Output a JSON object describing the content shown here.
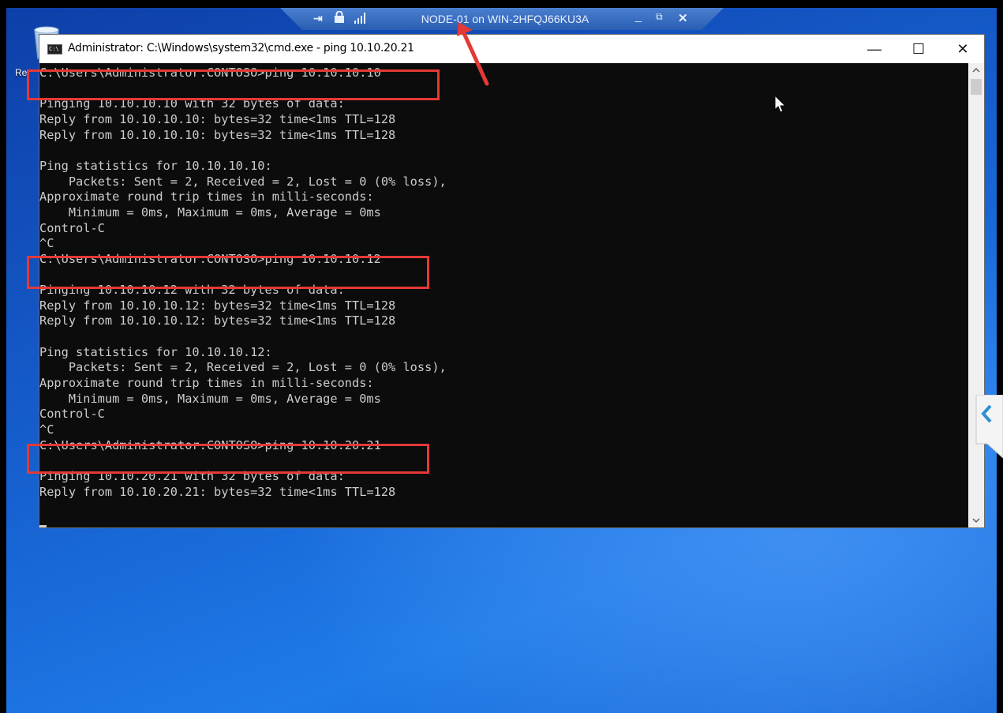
{
  "desktop": {
    "recycle_bin_label": "Re"
  },
  "rdp_bar": {
    "title": "NODE-01 on WIN-2HFQJ66KU3A",
    "pin_icon": "pin-icon",
    "lock_icon": "lock-icon",
    "signal_icon": "signal-bars-icon",
    "minimize_label": "_",
    "restore_label": "⧉",
    "close_label": "✕"
  },
  "cmd_window": {
    "title": "Administrator: C:\\Windows\\system32\\cmd.exe - ping  10.10.20.21",
    "icon_text": "C:\\",
    "minimize_label": "—",
    "maximize_label": "☐",
    "close_label": "✕",
    "console_lines": [
      "C:\\Users\\Administrator.CONTOSO>ping 10.10.10.10",
      "",
      "Pinging 10.10.10.10 with 32 bytes of data:",
      "Reply from 10.10.10.10: bytes=32 time<1ms TTL=128",
      "Reply from 10.10.10.10: bytes=32 time<1ms TTL=128",
      "",
      "Ping statistics for 10.10.10.10:",
      "    Packets: Sent = 2, Received = 2, Lost = 0 (0% loss),",
      "Approximate round trip times in milli-seconds:",
      "    Minimum = 0ms, Maximum = 0ms, Average = 0ms",
      "Control-C",
      "^C",
      "C:\\Users\\Administrator.CONTOSO>ping 10.10.10.12",
      "",
      "Pinging 10.10.10.12 with 32 bytes of data:",
      "Reply from 10.10.10.12: bytes=32 time<1ms TTL=128",
      "Reply from 10.10.10.12: bytes=32 time<1ms TTL=128",
      "",
      "Ping statistics for 10.10.10.12:",
      "    Packets: Sent = 2, Received = 2, Lost = 0 (0% loss),",
      "Approximate round trip times in milli-seconds:",
      "    Minimum = 0ms, Maximum = 0ms, Average = 0ms",
      "Control-C",
      "^C",
      "C:\\Users\\Administrator.CONTOSO>ping 10.10.20.21",
      "",
      "Pinging 10.10.20.21 with 32 bytes of data:",
      "Reply from 10.10.20.21: bytes=32 time<1ms TTL=128"
    ]
  },
  "colors": {
    "console_bg": "#0c0c0c",
    "console_text": "#cccccc",
    "highlight": "#e53935",
    "desktop_blue": "#1660d0"
  }
}
